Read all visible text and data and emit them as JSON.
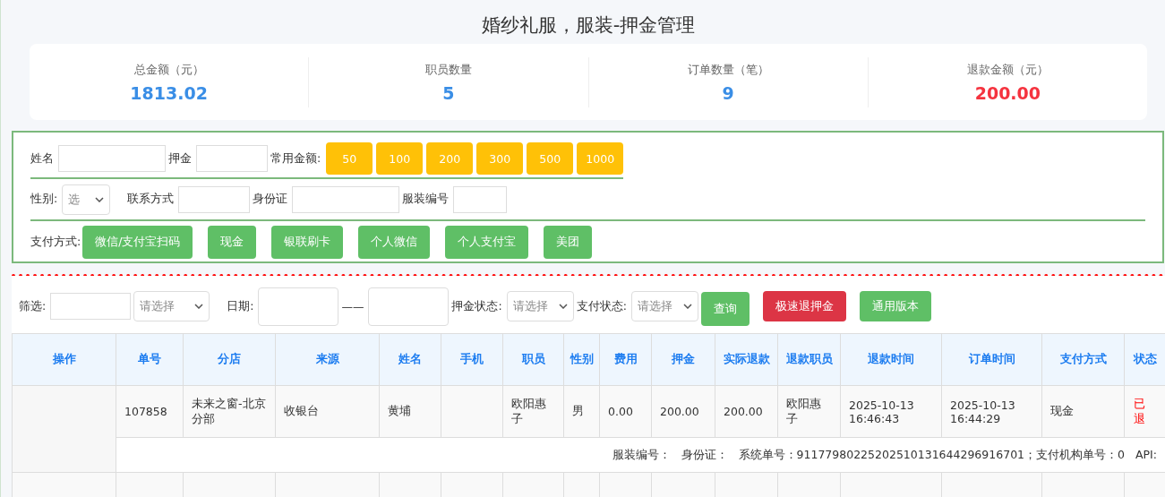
{
  "title": "婚纱礼服，服装-押金管理",
  "stats": [
    {
      "label": "总金额（元）",
      "value": "1813.02",
      "color": "#3a8ee6"
    },
    {
      "label": "职员数量",
      "value": "5",
      "color": "#3a8ee6"
    },
    {
      "label": "订单数量（笔）",
      "value": "9",
      "color": "#3a8ee6"
    },
    {
      "label": "退款金额（元）",
      "value": "200.00",
      "color": "#f5333f"
    }
  ],
  "form": {
    "name_label": "姓名",
    "deposit_label": "押金",
    "amounts_label": "常用金额:",
    "amounts": [
      "50",
      "100",
      "200",
      "300",
      "500",
      "1000"
    ],
    "gender_label": "性别:",
    "gender_select": "选",
    "contact_label": "联系方式",
    "id_label": "身份证",
    "garment_label": "服装编号",
    "payment_label": "支付方式:",
    "payments": [
      "微信/支付宝扫码",
      "现金",
      "银联刷卡",
      "个人微信",
      "个人支付宝",
      "美团"
    ]
  },
  "filter": {
    "filter_label": "筛选:",
    "filter_select": "请选择",
    "date_label": "日期:",
    "date_sep": "——",
    "deposit_status_label": "押金状态:",
    "deposit_status_select": "请选择",
    "pay_status_label": "支付状态:",
    "pay_status_select": "请选择",
    "buttons": [
      {
        "label": "查询",
        "kind": "query"
      },
      {
        "label": "极速退押金",
        "kind": "danger"
      },
      {
        "label": "通用版本",
        "kind": "success"
      }
    ]
  },
  "table": {
    "columns": [
      "操作",
      "单号",
      "分店",
      "来源",
      "姓名",
      "手机",
      "职员",
      "性别",
      "费用",
      "押金",
      "实际退款",
      "退款职员",
      "退款时间",
      "订单时间",
      "支付方式",
      "状态"
    ],
    "rows": [
      {
        "cells": [
          "",
          "107858",
          "未来之窗-北京分部",
          "收银台",
          "黄埔",
          "",
          "欧阳惠子",
          "男",
          "0.00",
          "200.00",
          "200.00",
          "欧阳惠子",
          "2025-10-13 16:46:43",
          "2025-10-13 16:44:29",
          "现金",
          "已退"
        ],
        "details": [
          "服装编号：",
          "身份证：",
          "系统单号：91177980225202510131644296916701；支付机构单号：0",
          "API:"
        ]
      }
    ]
  }
}
